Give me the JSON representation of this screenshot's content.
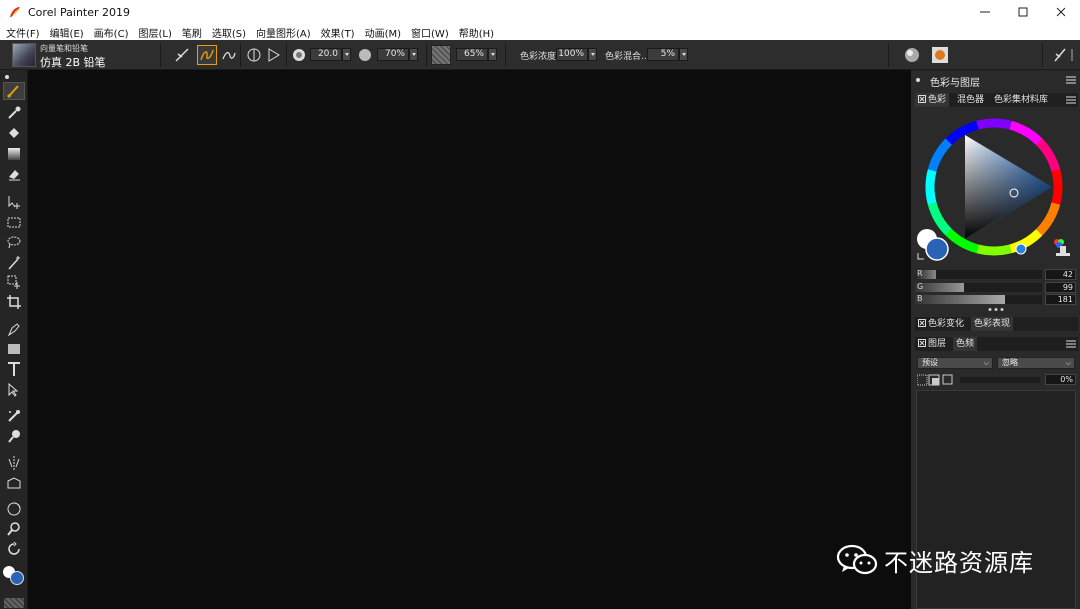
{
  "window": {
    "title": "Corel Painter 2019",
    "controls": [
      "minimize-icon",
      "maximize-icon",
      "close-icon"
    ]
  },
  "menu": [
    "文件(F)",
    "编辑(E)",
    "画布(C)",
    "图层(L)",
    "笔刷",
    "选取(S)",
    "向量图形(A)",
    "效果(T)",
    "动画(M)",
    "窗口(W)",
    "帮助(H)"
  ],
  "property_bar": {
    "brush_category": "向量笔和铅笔",
    "brush_variant": "仿真 2B 铅笔",
    "size": "20.0",
    "opacity": "70%",
    "grain": "65%",
    "resaturation_label": "色彩浓度:",
    "resaturation": "100%",
    "bleed_label": "色彩混合...",
    "bleed": "5%"
  },
  "toolbox": {
    "tools": [
      "brush-tool-icon",
      "dropper-icon",
      "paint-bucket-icon",
      "gradient-icon",
      "eraser-icon",
      "layer-adjuster-icon",
      "rectangle-select-icon",
      "lasso-icon",
      "magic-wand-icon",
      "transform-icon",
      "crop-icon",
      "pen-icon",
      "rectangle-shape-icon",
      "text-icon",
      "shape-selection-icon",
      "cloner-icon",
      "rubber-stamp-icon",
      "mirror-icon",
      "perspective-icon",
      "divine-proportion-icon",
      "magnifier-icon",
      "rotate-page-icon"
    ],
    "active_tool": "brush-tool-icon"
  },
  "panels": {
    "color_group_title": "色彩与图层",
    "color_tabs": [
      "色彩",
      "混色器",
      "色彩集材料库"
    ],
    "rgb": {
      "r_label": "R",
      "r": "42",
      "g_label": "G",
      "g": "99",
      "b_label": "B",
      "b": "181"
    },
    "color_var_tabs": [
      "色彩变化",
      "色彩表现"
    ],
    "layer_tabs": [
      "图层",
      "色频"
    ],
    "layer_blend_preset": "预设",
    "layer_composite": "忽略",
    "layer_opacity": "0%"
  },
  "colors": {
    "main_color": "#2a63b5",
    "secondary_color": "#ffffff",
    "canvas": "#0c0c0c",
    "accent_active": "#e5a000"
  },
  "watermark": {
    "text": "不迷路资源库"
  }
}
